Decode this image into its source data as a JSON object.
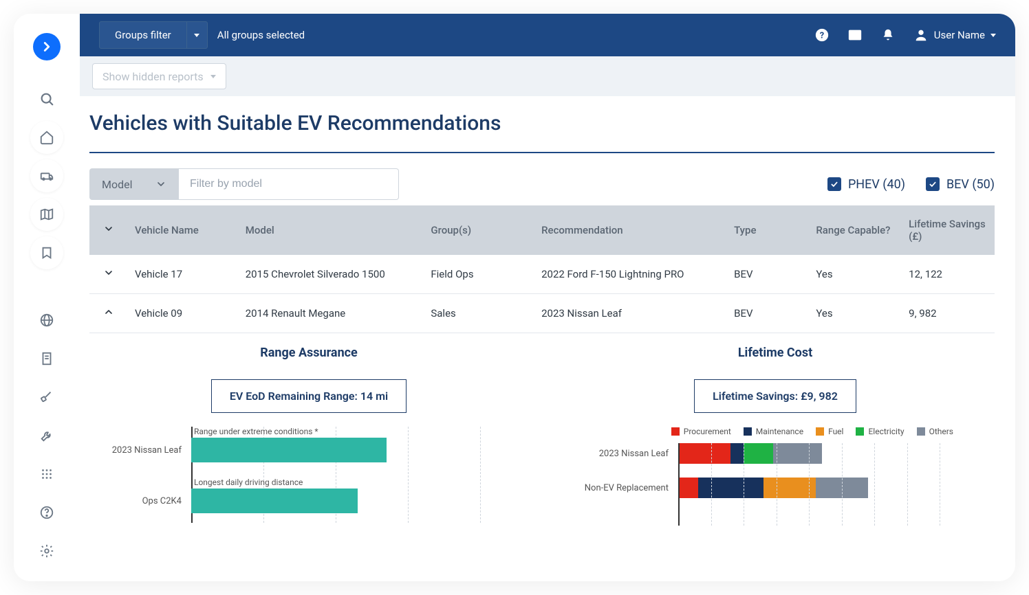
{
  "header": {
    "groups_filter_label": "Groups filter",
    "groups_selected": "All groups selected",
    "user_name": "User Name"
  },
  "subheader": {
    "hidden_reports_label": "Show hidden reports"
  },
  "page_title": "Vehicles with Suitable EV Recommendations",
  "filters": {
    "model_label": "Model",
    "model_placeholder": "Filter by model",
    "phev_label": "PHEV (40)",
    "bev_label": "BEV (50)"
  },
  "table": {
    "headers": {
      "vehicle_name": "Vehicle Name",
      "model": "Model",
      "group": "Group(s)",
      "recommendation": "Recommendation",
      "type": "Type",
      "range": "Range Capable?",
      "savings": "Lifetime Savings (£)"
    },
    "rows": [
      {
        "expanded": false,
        "vehicle_name": "Vehicle 17",
        "model": "2015 Chevrolet Silverado 1500",
        "group": "Field Ops",
        "recommendation": "2022 Ford F-150 Lightning PRO",
        "type": "BEV",
        "range": "Yes",
        "savings": "12, 122"
      },
      {
        "expanded": true,
        "vehicle_name": "Vehicle 09",
        "model": "2014 Renault Megane",
        "group": "Sales",
        "recommendation": "2023 Nissan Leaf",
        "type": "BEV",
        "range": "Yes",
        "savings": "9, 982"
      }
    ]
  },
  "detail": {
    "range_title": "Range Assurance",
    "range_kpi": "EV EoD Remaining Range: 14 mi",
    "cost_title": "Lifetime Cost",
    "cost_kpi": "Lifetime Savings: £9, 982",
    "legend": {
      "procurement": "Procurement",
      "maintenance": "Maintenance",
      "fuel": "Fuel",
      "electricity": "Electricity",
      "others": "Others"
    }
  },
  "colors": {
    "procurement": "#e32619",
    "maintenance": "#17315c",
    "fuel": "#e98f1e",
    "electricity": "#1fb244",
    "others": "#7e8a9a",
    "range_bar": "#2eb6a4"
  },
  "chart_data": [
    {
      "type": "bar",
      "title": "Range Assurance",
      "categories": [
        "2023 Nissan Leaf",
        "Ops C2K4"
      ],
      "captions": [
        "Range under extreme conditions *",
        "Longest daily driving distance"
      ],
      "values": [
        135,
        115
      ],
      "xlim": [
        0,
        200
      ],
      "xlabel": "",
      "ylabel": ""
    },
    {
      "type": "bar",
      "subtype": "stacked",
      "title": "Lifetime Cost",
      "categories": [
        "2023 Nissan Leaf",
        "Non-EV Replacement"
      ],
      "series": [
        {
          "name": "Procurement",
          "values": [
            80,
            30
          ],
          "color": "#e32619"
        },
        {
          "name": "Maintenance",
          "values": [
            20,
            100
          ],
          "color": "#17315c"
        },
        {
          "name": "Fuel",
          "values": [
            0,
            80
          ],
          "color": "#e98f1e"
        },
        {
          "name": "Electricity",
          "values": [
            45,
            0
          ],
          "color": "#1fb244"
        },
        {
          "name": "Others",
          "values": [
            75,
            80
          ],
          "color": "#7e8a9a"
        }
      ],
      "xlim": [
        0,
        400
      ],
      "xlabel": "",
      "ylabel": ""
    }
  ]
}
